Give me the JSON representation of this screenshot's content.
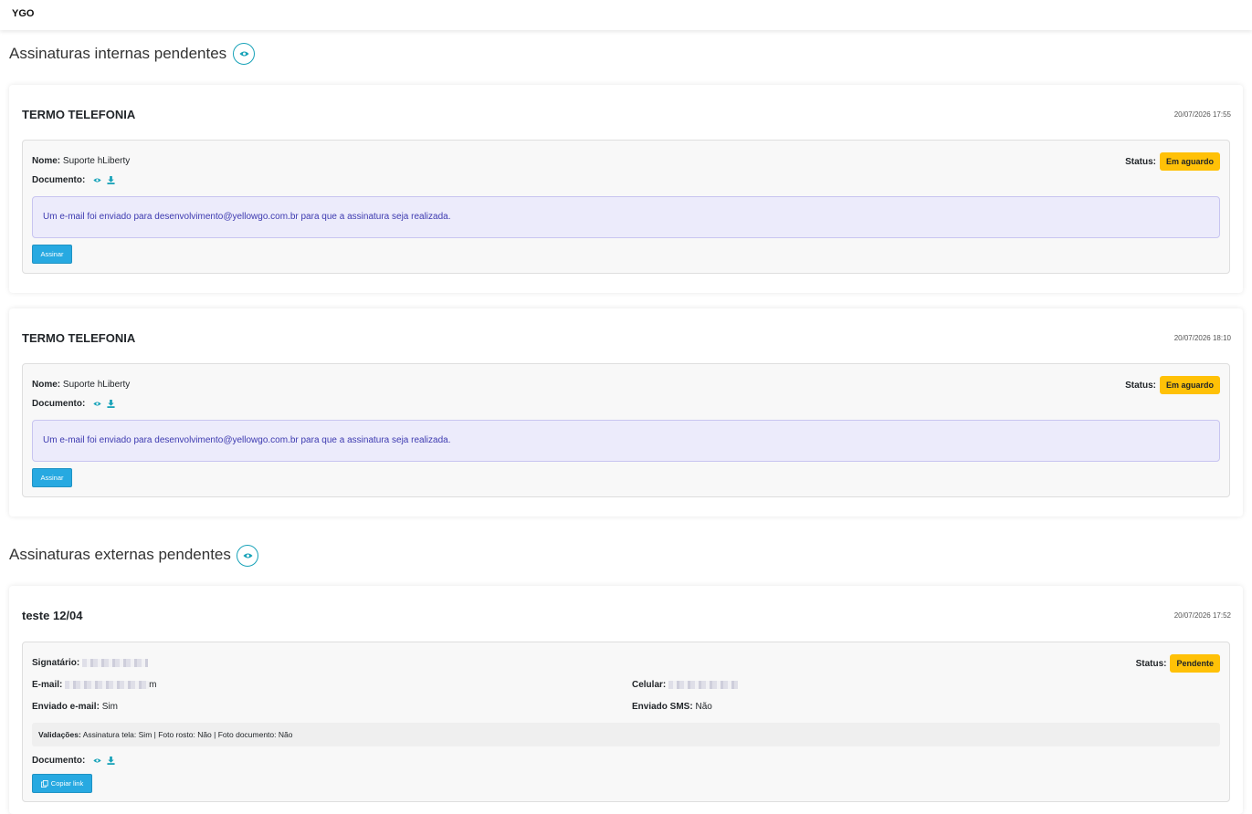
{
  "header": {
    "brand": "YGO"
  },
  "internal_section": {
    "title": "Assinaturas internas pendentes",
    "cards": [
      {
        "title": "TERMO TELEFONIA",
        "date": "20/07/2026 17:55",
        "name_label": "Nome:",
        "name_value": "Suporte hLiberty",
        "document_label": "Documento:",
        "status_label": "Status:",
        "status_value": "Em aguardo",
        "alert": "Um e-mail foi enviado para desenvolvimento@yellowgo.com.br para que a assinatura seja realizada.",
        "button": "Assinar"
      },
      {
        "title": "TERMO TELEFONIA",
        "date": "20/07/2026 18:10",
        "name_label": "Nome:",
        "name_value": "Suporte hLiberty",
        "document_label": "Documento:",
        "status_label": "Status:",
        "status_value": "Em aguardo",
        "alert": "Um e-mail foi enviado para desenvolvimento@yellowgo.com.br para que a assinatura seja realizada.",
        "button": "Assinar"
      }
    ]
  },
  "external_section": {
    "title": "Assinaturas externas pendentes",
    "card": {
      "title": "teste 12/04",
      "date": "20/07/2026 17:52",
      "signer_label": "Signatário:",
      "email_label": "E-mail:",
      "email_suffix": "m",
      "phone_label": "Celular:",
      "sent_email_label": "Enviado e-mail:",
      "sent_email_value": "Sim",
      "sent_sms_label": "Enviado SMS:",
      "sent_sms_value": "Não",
      "validations_label": "Validações:",
      "validations_value": "Assinatura tela: Sim | Foto rosto: Não | Foto documento: Não",
      "document_label": "Documento:",
      "status_label": "Status:",
      "status_value": "Pendente",
      "button": "Copiar link"
    }
  },
  "colors": {
    "accent": "#27a9e1",
    "badge": "#ffc107",
    "icon": "#17a2b8"
  }
}
